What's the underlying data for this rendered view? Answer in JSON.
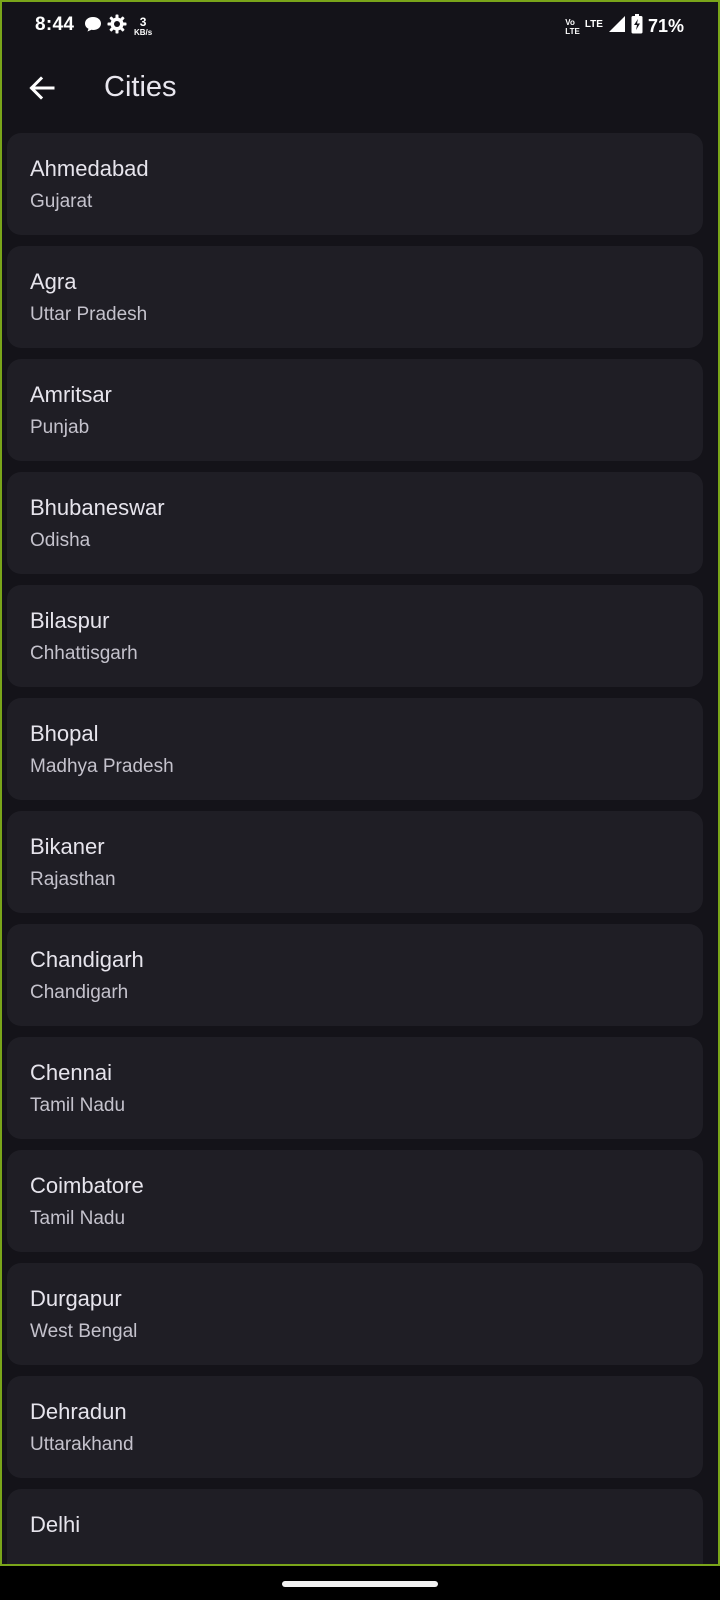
{
  "status_bar": {
    "time": "8:44",
    "speed_value": "3",
    "speed_unit": "KB/s",
    "volte_top": "Vo",
    "volte_bottom": "LTE",
    "lte": "LTE",
    "battery": "71%"
  },
  "app_bar": {
    "title": "Cities"
  },
  "cities": [
    {
      "name": "Ahmedabad",
      "state": "Gujarat"
    },
    {
      "name": "Agra",
      "state": "Uttar Pradesh"
    },
    {
      "name": "Amritsar",
      "state": "Punjab"
    },
    {
      "name": "Bhubaneswar",
      "state": "Odisha"
    },
    {
      "name": "Bilaspur",
      "state": "Chhattisgarh"
    },
    {
      "name": "Bhopal",
      "state": "Madhya Pradesh"
    },
    {
      "name": "Bikaner",
      "state": "Rajasthan"
    },
    {
      "name": "Chandigarh",
      "state": "Chandigarh"
    },
    {
      "name": "Chennai",
      "state": "Tamil Nadu"
    },
    {
      "name": "Coimbatore",
      "state": "Tamil Nadu"
    },
    {
      "name": "Durgapur",
      "state": "West Bengal"
    },
    {
      "name": "Dehradun",
      "state": "Uttarakhand"
    },
    {
      "name": "Delhi",
      "state": ""
    }
  ],
  "colors": {
    "background": "#141319",
    "card": "#1f1e25",
    "frame_border": "#7aa51a"
  }
}
